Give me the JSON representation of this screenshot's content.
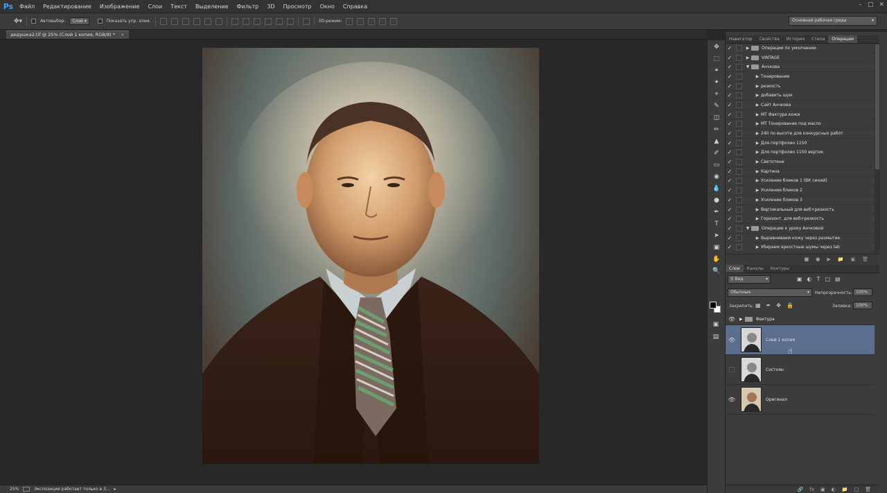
{
  "app": {
    "logo": "Ps"
  },
  "menu": [
    "Файл",
    "Редактирование",
    "Изображение",
    "Слои",
    "Текст",
    "Выделение",
    "Фильтр",
    "3D",
    "Просмотр",
    "Окно",
    "Справка"
  ],
  "options": {
    "autoselect_label": "Автовыбор:",
    "autoselect_value": "Слой",
    "show_controls_label": "Показать упр. элем.",
    "mode3d_label": "3D-режим:",
    "workspace": "Основная рабочая среда"
  },
  "document": {
    "tab_title": "дедушка2.tif @ 25% (Слой 1 копия, RGB/8) *"
  },
  "status": {
    "zoom": "25%",
    "message": "Экспозиция работает только в 3..."
  },
  "actions_panel": {
    "tabs": [
      "Навигатор",
      "Свойства",
      "История",
      "Стили",
      "Операции"
    ],
    "active_tab": "Операции",
    "items": [
      {
        "label": "Операции по умолчанию",
        "type": "set",
        "expanded": false
      },
      {
        "label": "VINTAGE",
        "type": "set",
        "expanded": false
      },
      {
        "label": "Анчкова",
        "type": "set",
        "expanded": true
      },
      {
        "label": "Тонирование",
        "type": "action"
      },
      {
        "label": "резкость",
        "type": "action"
      },
      {
        "label": "добавить шум",
        "type": "action"
      },
      {
        "label": "Сайт Анчкова",
        "type": "action"
      },
      {
        "label": "МТ Фактура кожи",
        "type": "action"
      },
      {
        "label": "МТ Тонирование под масло",
        "type": "action"
      },
      {
        "label": "240 по высоте для конкурсных работ",
        "type": "action"
      },
      {
        "label": "Для портфолио 1150",
        "type": "action"
      },
      {
        "label": "Для портфолио 1150 вертик",
        "type": "action"
      },
      {
        "label": "Светотени",
        "type": "action"
      },
      {
        "label": "Картина",
        "type": "action"
      },
      {
        "label": "Усиление бликов 1 (ВК синий)",
        "type": "action"
      },
      {
        "label": "Усиление бликов 2",
        "type": "action"
      },
      {
        "label": "Усиление бликов 3",
        "type": "action"
      },
      {
        "label": "Вертикальный для веб+резкость",
        "type": "action"
      },
      {
        "label": "Горизонт. для веб+резкость",
        "type": "action"
      },
      {
        "label": "Операции к уроку Анчковой",
        "type": "set",
        "expanded": true
      },
      {
        "label": "Выравниваем кожу через размытие",
        "type": "action"
      },
      {
        "label": "Убираем яркостные шумы через lab",
        "type": "action"
      }
    ]
  },
  "layers_panel": {
    "tabs": [
      "Слои",
      "Каналы",
      "Контуры"
    ],
    "active_tab": "Слои",
    "filter": "Вид",
    "blend_mode": "Обычные",
    "opacity_label": "Непрозрачность:",
    "opacity_value": "100%",
    "lock_label": "Закрепить:",
    "fill_label": "Заливка:",
    "fill_value": "100%",
    "layers": [
      {
        "name": "Фактура",
        "type": "group",
        "visible": true,
        "selected": false
      },
      {
        "name": "Слой 1 копия",
        "type": "layer",
        "visible": true,
        "selected": true
      },
      {
        "name": "Состоян",
        "type": "layer",
        "visible": false,
        "selected": false
      },
      {
        "name": "Оригинал",
        "type": "layer",
        "visible": true,
        "selected": false
      }
    ]
  },
  "colors": {
    "accent": "#31a8ff",
    "selected_layer": "#5b6e8e",
    "foreground": "#000000",
    "background": "#ffffff"
  }
}
